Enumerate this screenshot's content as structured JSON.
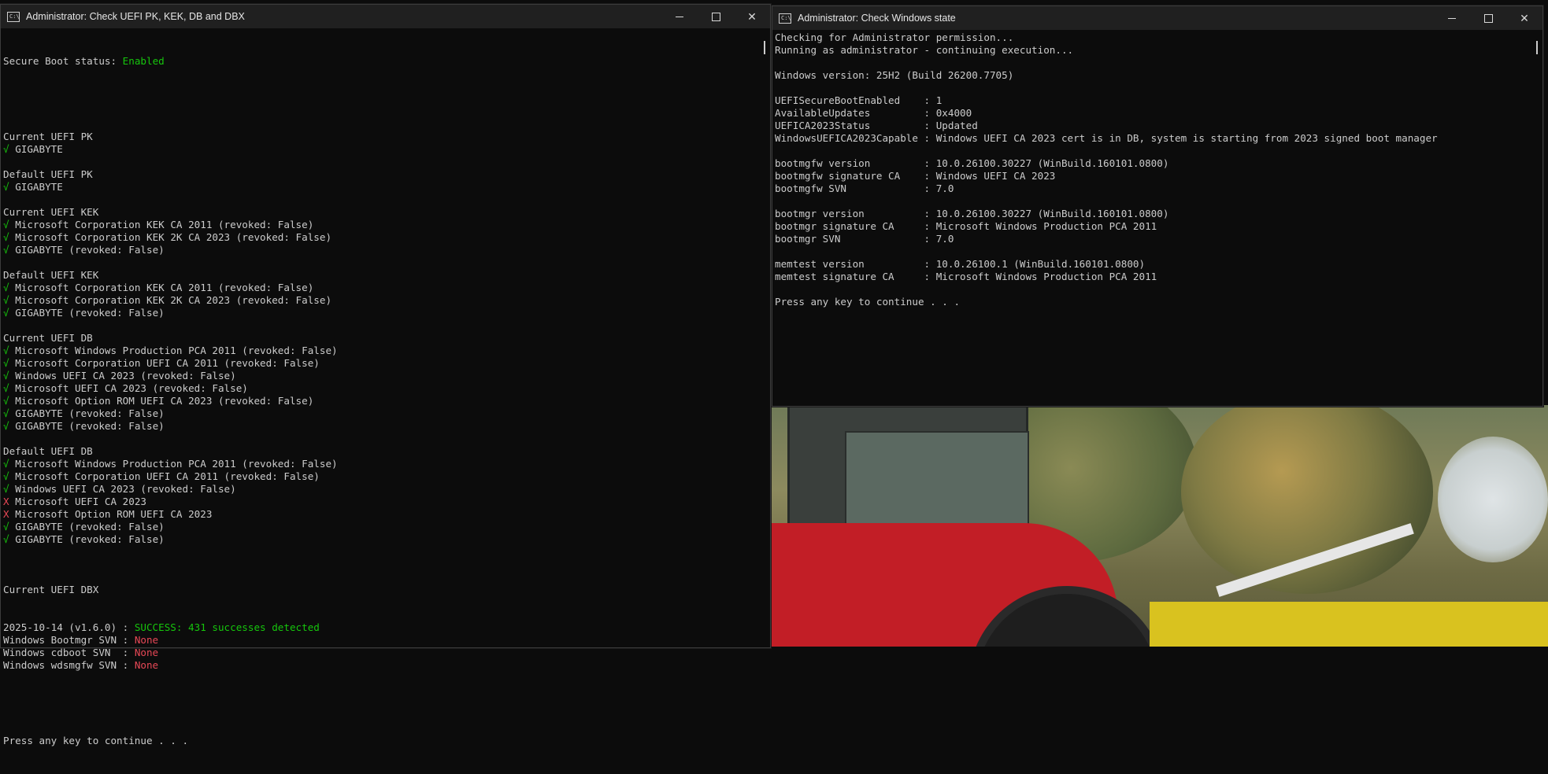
{
  "left_window": {
    "title": "Administrator:  Check UEFI PK, KEK, DB and DBX",
    "secure_boot": {
      "label": "Secure Boot status: ",
      "value": "Enabled"
    },
    "sections": [
      {
        "header": "Current UEFI PK",
        "items": [
          {
            "mark": "√",
            "text": "GIGABYTE",
            "ok": true
          }
        ]
      },
      {
        "header": "Default UEFI PK",
        "items": [
          {
            "mark": "√",
            "text": "GIGABYTE",
            "ok": true
          }
        ]
      },
      {
        "header": "Current UEFI KEK",
        "items": [
          {
            "mark": "√",
            "text": "Microsoft Corporation KEK CA 2011 (revoked: False)",
            "ok": true
          },
          {
            "mark": "√",
            "text": "Microsoft Corporation KEK 2K CA 2023 (revoked: False)",
            "ok": true
          },
          {
            "mark": "√",
            "text": "GIGABYTE (revoked: False)",
            "ok": true
          }
        ]
      },
      {
        "header": "Default UEFI KEK",
        "items": [
          {
            "mark": "√",
            "text": "Microsoft Corporation KEK CA 2011 (revoked: False)",
            "ok": true
          },
          {
            "mark": "√",
            "text": "Microsoft Corporation KEK 2K CA 2023 (revoked: False)",
            "ok": true
          },
          {
            "mark": "√",
            "text": "GIGABYTE (revoked: False)",
            "ok": true
          }
        ]
      },
      {
        "header": "Current UEFI DB",
        "items": [
          {
            "mark": "√",
            "text": "Microsoft Windows Production PCA 2011 (revoked: False)",
            "ok": true
          },
          {
            "mark": "√",
            "text": "Microsoft Corporation UEFI CA 2011 (revoked: False)",
            "ok": true
          },
          {
            "mark": "√",
            "text": "Windows UEFI CA 2023 (revoked: False)",
            "ok": true
          },
          {
            "mark": "√",
            "text": "Microsoft UEFI CA 2023 (revoked: False)",
            "ok": true
          },
          {
            "mark": "√",
            "text": "Microsoft Option ROM UEFI CA 2023 (revoked: False)",
            "ok": true
          },
          {
            "mark": "√",
            "text": "GIGABYTE (revoked: False)",
            "ok": true
          },
          {
            "mark": "√",
            "text": "GIGABYTE (revoked: False)",
            "ok": true
          }
        ]
      },
      {
        "header": "Default UEFI DB",
        "items": [
          {
            "mark": "√",
            "text": "Microsoft Windows Production PCA 2011 (revoked: False)",
            "ok": true
          },
          {
            "mark": "√",
            "text": "Microsoft Corporation UEFI CA 2011 (revoked: False)",
            "ok": true
          },
          {
            "mark": "√",
            "text": "Windows UEFI CA 2023 (revoked: False)",
            "ok": true
          },
          {
            "mark": "X",
            "text": "Microsoft UEFI CA 2023",
            "ok": false
          },
          {
            "mark": "X",
            "text": "Microsoft Option ROM UEFI CA 2023",
            "ok": false
          },
          {
            "mark": "√",
            "text": "GIGABYTE (revoked: False)",
            "ok": true
          },
          {
            "mark": "√",
            "text": "GIGABYTE (revoked: False)",
            "ok": true
          }
        ]
      }
    ],
    "dbx": {
      "header": "Current UEFI DBX",
      "rows": [
        {
          "label": "2025-10-14 (v1.6.0) : ",
          "value": "SUCCESS: 431 successes detected",
          "ok": true
        },
        {
          "label": "Windows Bootmgr SVN : ",
          "value": "None",
          "ok": false
        },
        {
          "label": "Windows cdboot SVN  : ",
          "value": "None",
          "ok": false
        },
        {
          "label": "Windows wdsmgfw SVN : ",
          "value": "None",
          "ok": false
        }
      ]
    },
    "prompt": "Press any key to continue . . ."
  },
  "right_window": {
    "title": "Administrator:  Check Windows state",
    "lines": [
      "Checking for Administrator permission...",
      "Running as administrator - continuing execution...",
      "",
      "Windows version: 25H2 (Build 26200.7705)",
      "",
      "UEFISecureBootEnabled    : 1",
      "AvailableUpdates         : 0x4000",
      "UEFICA2023Status         : Updated",
      "WindowsUEFICA2023Capable : Windows UEFI CA 2023 cert is in DB, system is starting from 2023 signed boot manager",
      "",
      "bootmgfw version         : 10.0.26100.30227 (WinBuild.160101.0800)",
      "bootmgfw signature CA    : Windows UEFI CA 2023",
      "bootmgfw SVN             : 7.0",
      "",
      "bootmgr version          : 10.0.26100.30227 (WinBuild.160101.0800)",
      "bootmgr signature CA     : Microsoft Windows Production PCA 2011",
      "bootmgr SVN              : 7.0",
      "",
      "memtest version          : 10.0.26100.1 (WinBuild.160101.0800)",
      "memtest signature CA     : Microsoft Windows Production PCA 2011",
      "",
      "Press any key to continue . . ."
    ]
  },
  "colors": {
    "ok": "#16c60c",
    "bad": "#e74856",
    "text": "#cccccc",
    "titlebar": "#202020"
  },
  "icons": {
    "app": "console-icon",
    "minimize": "minimize-icon",
    "maximize": "maximize-icon",
    "close": "close-icon"
  }
}
